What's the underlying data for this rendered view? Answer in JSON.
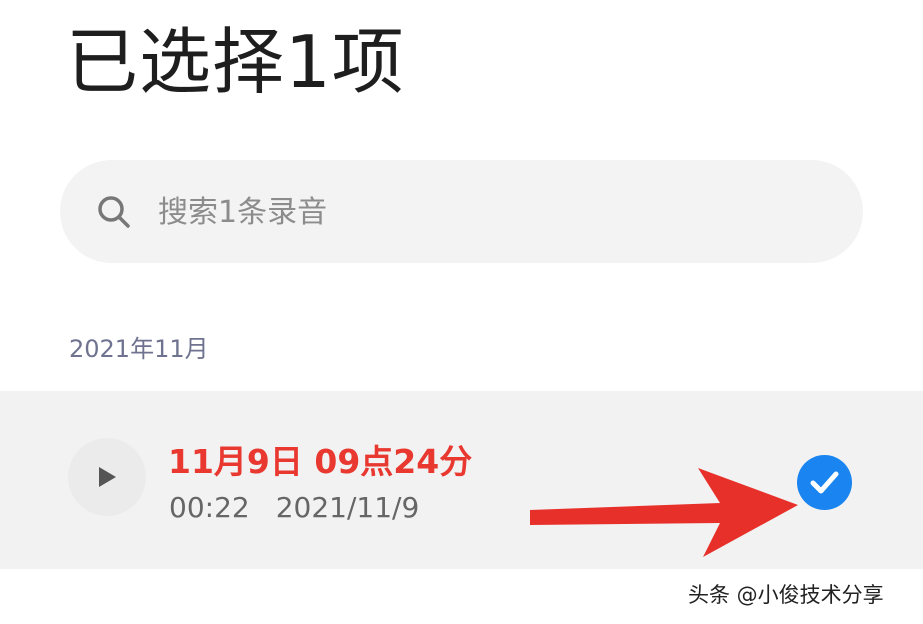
{
  "header": {
    "title": "已选择1项"
  },
  "search": {
    "placeholder": "搜索1条录音",
    "icon": "search-icon"
  },
  "list": {
    "section_header": "2021年11月",
    "items": [
      {
        "title": "11月9日 09点24分",
        "duration": "00:22",
        "date": "2021/11/9",
        "selected": true
      }
    ]
  },
  "colors": {
    "title_text": "#1e1e1e",
    "recording_title": "#e8382f",
    "check_blue": "#1a84f0",
    "arrow_red": "#e8302a",
    "search_bg": "#f3f3f3",
    "row_bg": "#f2f2f2"
  },
  "watermark": {
    "text": "头条 @小俊技术分享"
  }
}
